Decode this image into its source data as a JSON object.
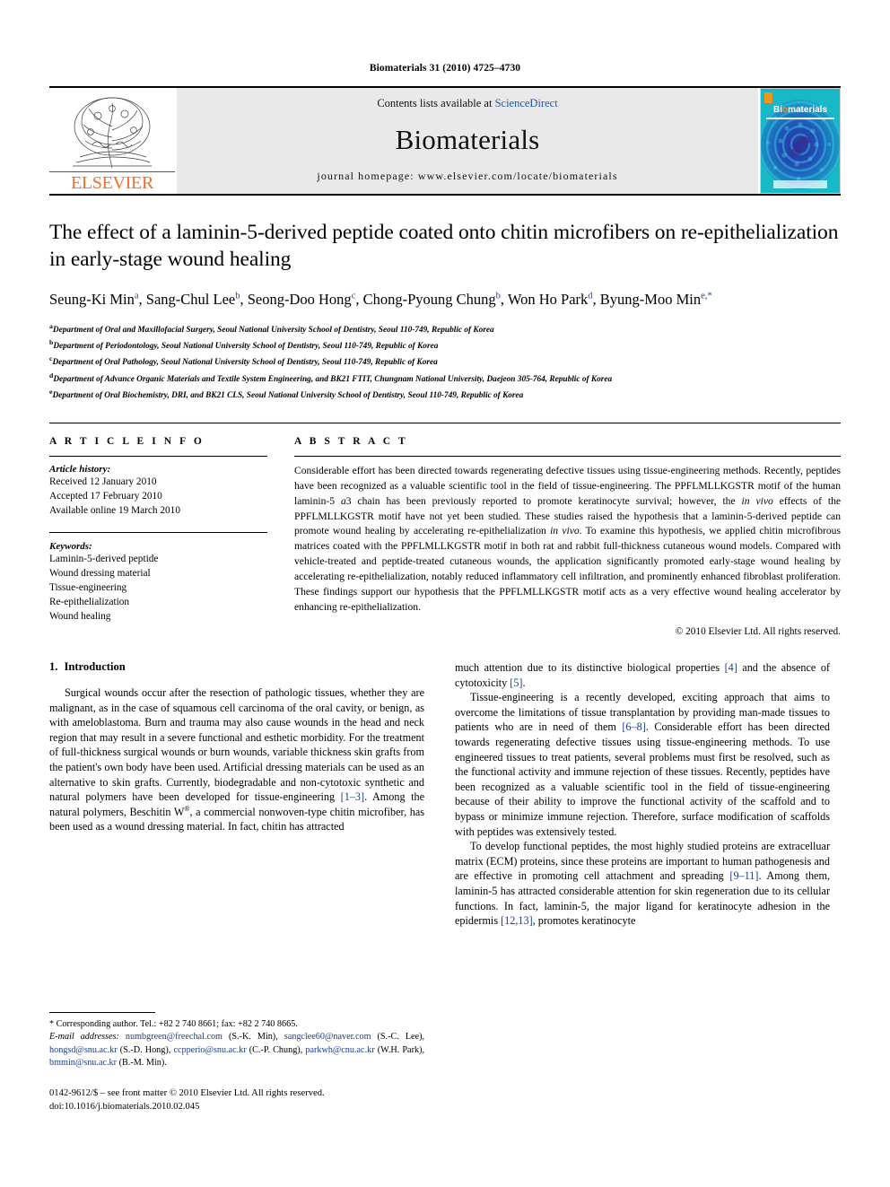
{
  "running_head": "Biomaterials 31 (2010) 4725–4730",
  "masthead": {
    "publisher_wordmark": "ELSEVIER",
    "contents_prefix": "Contents lists available at ",
    "contents_link": "ScienceDirect",
    "journal_name": "Biomaterials",
    "homepage": "journal homepage: www.elsevier.com/locate/biomaterials",
    "cover": {
      "title_first": "Bi",
      "title_accent": "o",
      "title_rest": "materials"
    }
  },
  "article": {
    "title": "The effect of a laminin-5-derived peptide coated onto chitin microfibers on re-epithelialization in early-stage wound healing",
    "authors": [
      {
        "name": "Seung-Ki Min",
        "sup": "a",
        "sep": ", "
      },
      {
        "name": "Sang-Chul Lee",
        "sup": "b",
        "sep": ", "
      },
      {
        "name": "Seong-Doo Hong",
        "sup": "c",
        "sep": ", "
      },
      {
        "name": "Chong-Pyoung Chung",
        "sup": "b",
        "sep": ", "
      },
      {
        "name": "Won Ho Park",
        "sup": "d",
        "sep": ", "
      },
      {
        "name": "Byung-Moo Min",
        "sup": "e,*",
        "sep": ""
      }
    ],
    "affiliations": [
      {
        "label": "a",
        "text": "Department of Oral and Maxillofacial Surgery, Seoul National University School of Dentistry, Seoul 110-749, Republic of Korea"
      },
      {
        "label": "b",
        "text": "Department of Periodontology, Seoul National University School of Dentistry, Seoul 110-749, Republic of Korea"
      },
      {
        "label": "c",
        "text": "Department of Oral Pathology, Seoul National University School of Dentistry, Seoul 110-749, Republic of Korea"
      },
      {
        "label": "d",
        "text": "Department of Advance Organic Materials and Textile System Engineering, and BK21 FTIT, Chungnam National University, Daejeon 305-764, Republic of Korea"
      },
      {
        "label": "e",
        "text": "Department of Oral Biochemistry, DRI, and BK21 CLS, Seoul National University School of Dentistry, Seoul 110-749, Republic of Korea"
      }
    ]
  },
  "article_info": {
    "heading": "A R T I C L E   I N F O",
    "history_label": "Article history:",
    "history": [
      "Received 12 January 2010",
      "Accepted 17 February 2010",
      "Available online 19 March 2010"
    ],
    "keywords_label": "Keywords:",
    "keywords": [
      "Laminin-5-derived peptide",
      "Wound dressing material",
      "Tissue-engineering",
      "Re-epithelialization",
      "Wound healing"
    ]
  },
  "abstract": {
    "heading": "A B S T R A C T",
    "part1": "Considerable effort has been directed towards regenerating defective tissues using tissue-engineering methods. Recently, peptides have been recognized as a valuable scientific tool in the field of tissue-engineering. The PPFLMLLKGSTR motif of the human laminin-5 ",
    "italic1": "a",
    "part2": "3 chain has been previously reported to promote keratinocyte survival; however, the ",
    "italic2": "in vivo",
    "part3": " effects of the PPFLMLLKGSTR motif have not yet been studied. These studies raised the hypothesis that a laminin-5-derived peptide can promote wound healing by accelerating re-epithelialization ",
    "italic3": "in vivo",
    "part4": ". To examine this hypothesis, we applied chitin microfibrous matrices coated with the PPFLMLLKGSTR motif in both rat and rabbit full-thickness cutaneous wound models. Compared with vehicle-treated and peptide-treated cutaneous wounds, the application significantly promoted early-stage wound healing by accelerating re-epithelialization, notably reduced inflammatory cell infiltration, and prominently enhanced fibroblast proliferation. These findings support our hypothesis that the PPFLMLLKGSTR motif acts as a very effective wound healing accelerator by enhancing re-epithelialization.",
    "copyright": "© 2010 Elsevier Ltd. All rights reserved."
  },
  "introduction": {
    "number": "1.",
    "title": "Introduction",
    "para1_a": "Surgical wounds occur after the resection of pathologic tissues, whether they are malignant, as in the case of squamous cell carcinoma of the oral cavity, or benign, as with ameloblastoma. Burn and trauma may also cause wounds in the head and neck region that may result in a severe functional and esthetic morbidity. For the treatment of full-thickness surgical wounds or burn wounds, variable thickness skin grafts from the patient's own body have been used. Artificial dressing materials can be used as an alternative to skin grafts. Currently, biodegradable and non-cytotoxic synthetic and natural polymers have been developed for tissue-engineering ",
    "ref1": "[1–3]",
    "para1_b": ". Among the natural polymers, Beschitin W",
    "reg": "®",
    "para1_c": ", a commercial nonwoven-type chitin microfiber, has been used as a wound dressing material. In fact, chitin has attracted much attention due to its distinctive biological properties ",
    "ref2": "[4]",
    "para1_d": " and the absence of cytotoxicity ",
    "ref3": "[5]",
    "para1_e": ".",
    "para2_a": "Tissue-engineering is a recently developed, exciting approach that aims to overcome the limitations of tissue transplantation by providing man-made tissues to patients who are in need of them ",
    "ref4": "[6–8]",
    "para2_b": ". Considerable effort has been directed towards regenerating defective tissues using tissue-engineering methods. To use engineered tissues to treat patients, several problems must first be resolved, such as the functional activity and immune rejection of these tissues. Recently, peptides have been recognized as a valuable scientific tool in the field of tissue-engineering because of their ability to improve the functional activity of the scaffold and to bypass or minimize immune rejection. Therefore, surface modification of scaffolds with peptides was extensively tested.",
    "para3_a": "To develop functional peptides, the most highly studied proteins are extracelluar matrix (ECM) proteins, since these proteins are important to human pathogenesis and are effective in promoting cell attachment and spreading ",
    "ref5": "[9–11]",
    "para3_b": ". Among them, laminin-5 has attracted considerable attention for skin regeneration due to its cellular functions. In fact, laminin-5, the major ligand for keratinocyte adhesion in the epidermis ",
    "ref6": "[12,13]",
    "para3_c": ", promotes keratinocyte"
  },
  "footnotes": {
    "corresponding": "* Corresponding author. Tel.: +82 2 740 8661; fax: +82 2 740 8665.",
    "email_label": "E-mail addresses:",
    "emails": [
      {
        "addr": "numbgreen@freechal.com",
        "who": " (S.-K. Min), "
      },
      {
        "addr": "sangclee60@naver.com",
        "who": " (S.-C. Lee), "
      },
      {
        "addr": "hongsd@snu.ac.kr",
        "who": " (S.-D. Hong), "
      },
      {
        "addr": "ccpperio@snu.ac.kr",
        "who": " (C.-P. Chung), "
      },
      {
        "addr": "parkwh@cnu.ac.kr",
        "who": " (W.H. Park), "
      },
      {
        "addr": "bmmin@snu.ac.kr",
        "who": " (B.-M. Min)."
      }
    ],
    "imprint_line1": "0142-9612/$ – see front matter © 2010 Elsevier Ltd. All rights reserved.",
    "imprint_line2": "doi:10.1016/j.biomaterials.2010.02.045"
  }
}
